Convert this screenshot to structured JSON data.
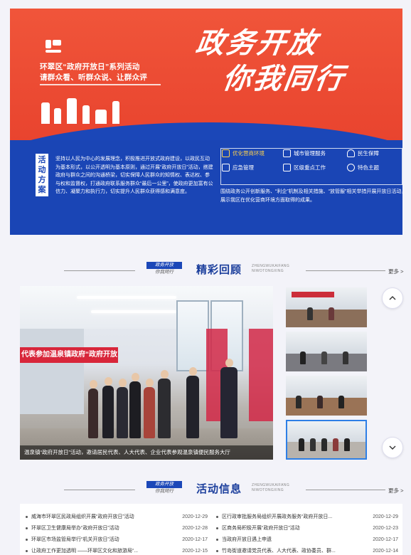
{
  "banner": {
    "subtitle_line1": "环翠区“政府开放日”系列活动",
    "subtitle_line2": "请群众看、听群众说、让群众评",
    "title_line1": "政务开放",
    "title_line2": "你我同行",
    "activity_tag": "活动方案",
    "activity_text": "坚持以人民为中心的发展理念，积极推进开放式政府建设，以政民互动为基本形式，以公开透明为基本原则，通过开展“政府开放日”活动，搭建政府与群众之间的沟通桥梁，切实保障人民群众的知情权、表达权、参与权和监督权，打通政府联系服务群众“最后一公里”，使政府更加富有公信力、凝聚力和执行力，切实提升人民群众获得感和满意度。",
    "services": [
      {
        "label": "优化营商环境",
        "icon": "building-icon",
        "highlight": true
      },
      {
        "label": "城市管理服务",
        "icon": "city-icon",
        "highlight": false
      },
      {
        "label": "民生保障",
        "icon": "house-icon",
        "highlight": false
      },
      {
        "label": "应急管理",
        "icon": "alarm-icon",
        "highlight": false
      },
      {
        "label": "区级重点工作",
        "icon": "task-icon",
        "highlight": false
      },
      {
        "label": "特色主题",
        "icon": "bulb-icon",
        "highlight": false
      }
    ],
    "services_desc": "围绕政务公开创新服务、“利企”机制及相关措施、“放管服”相关举措开展开放日活动，展示我区在优化营商环境方面取得的成果。",
    "colors": {
      "red": "#e9452f",
      "blue": "#1b47b8",
      "highlight": "#ffd34d"
    }
  },
  "highlights": {
    "badge_top": "政务开放",
    "badge_bottom": "你我同行",
    "title": "精彩回顾",
    "en_line1": "ZHENGWUKAIFANG",
    "en_line2": "NIWOTONGXING",
    "more": "更多 >",
    "main_banner_text": "代表参加温泉镇政府“政府开放日”活",
    "caption": "温泉镇“政府开放日”活动，邀请居民代表、人大代表、企业代表参观温泉镇便民服务大厅",
    "up_icon": "chevron-up-icon",
    "down_icon": "chevron-down-icon"
  },
  "news": {
    "badge_top": "政务开放",
    "badge_bottom": "你我同行",
    "title": "活动信息",
    "en_line1": "ZHENGWUKAIFANG",
    "en_line2": "NIWOTONGXING",
    "more": "更多 >",
    "left": [
      {
        "title": "威海市环翠区民政局组织开展“政府开放日”活动",
        "date": "2020-12-29"
      },
      {
        "title": "环翠区卫生健康局举办“政府开放日”活动",
        "date": "2020-12-28"
      },
      {
        "title": "环翠区市场监管局举行“机关开放日”活动",
        "date": "2020-12-17"
      },
      {
        "title": "让政府工作更加透明 ——环翠区文化和旅游局“...",
        "date": "2020-12-15"
      }
    ],
    "right": [
      {
        "title": "区行政审批服务局组织开展政务服务“政府开放日...",
        "date": "2020-12-29"
      },
      {
        "title": "区商务局积极开展“政府开放日”活动",
        "date": "2020-12-23"
      },
      {
        "title": "当政府开放日遇上申遗",
        "date": "2020-12-17"
      },
      {
        "title": "竹岛街道邀请党员代表、人大代表、政协委员、群...",
        "date": "2020-12-14"
      }
    ]
  }
}
